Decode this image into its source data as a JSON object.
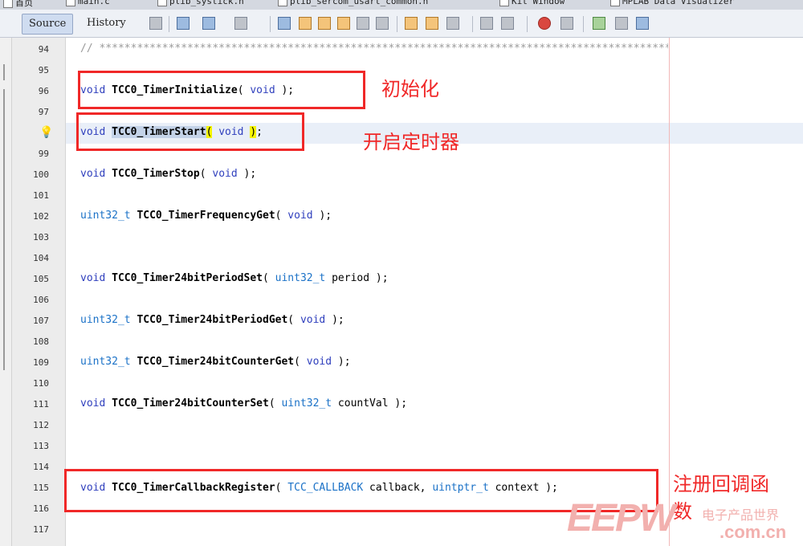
{
  "file_tabs": [
    {
      "label": "首页"
    },
    {
      "label": "main.c"
    },
    {
      "label": "plib_systick.h"
    },
    {
      "label": "plib_sercom_usart_common.h"
    },
    {
      "label": "Kit Window"
    },
    {
      "label": "MPLAB Data Visualizer"
    }
  ],
  "toolbar": {
    "source_label": "Source",
    "history_label": "History"
  },
  "editor": {
    "line_numbers": [
      "94",
      "95",
      "96",
      "97",
      "98",
      "99",
      "100",
      "101",
      "102",
      "103",
      "104",
      "105",
      "106",
      "107",
      "108",
      "109",
      "110",
      "111",
      "112",
      "113",
      "114",
      "115",
      "116",
      "117"
    ],
    "comment_line": "// ************************************************************************************************************",
    "lines": {
      "l96": {
        "kw": "void",
        "fn": "TCC0_TimerInitialize",
        "open": "(",
        "param_kw": "void",
        "close": ");"
      },
      "l98": {
        "kw": "void",
        "fn": "TCC0_TimerStart",
        "open": "(",
        "param_kw": "void",
        "close": ")",
        "semi": ";"
      },
      "l100": {
        "kw": "void",
        "fn": "TCC0_TimerStop",
        "open": "(",
        "param_kw": "void",
        "close": ");"
      },
      "l102": {
        "ty": "uint32_t",
        "fn": "TCC0_TimerFrequencyGet",
        "open": "(",
        "param_kw": "void",
        "close": ");"
      },
      "l105": {
        "kw": "void",
        "fn": "TCC0_Timer24bitPeriodSet",
        "open": "(",
        "param_ty": "uint32_t",
        "param_name": "period",
        "close": ");"
      },
      "l107": {
        "ty": "uint32_t",
        "fn": "TCC0_Timer24bitPeriodGet",
        "open": "(",
        "param_kw": "void",
        "close": ");"
      },
      "l109": {
        "ty": "uint32_t",
        "fn": "TCC0_Timer24bitCounterGet",
        "open": "(",
        "param_kw": "void",
        "close": ");"
      },
      "l111": {
        "kw": "void",
        "fn": "TCC0_Timer24bitCounterSet",
        "open": "(",
        "param_ty": "uint32_t",
        "param_name": "countVal",
        "close": ");"
      },
      "l115": {
        "kw": "void",
        "fn": "TCC0_TimerCallbackRegister",
        "open": "(",
        "param_ty": "TCC_CALLBACK",
        "param_name": "callback,",
        "param_ty2": "uintptr_t",
        "param_name2": "context",
        "close": ");"
      }
    }
  },
  "annotations": {
    "initialize": "初始化",
    "start_timer": "开启定时器",
    "register_callback_1": "注册回调函",
    "register_callback_2": "数"
  },
  "watermark": {
    "logo": "EEPW",
    "cn": "电子产品世界",
    "domain": ".com.cn"
  },
  "colors": {
    "keyword": "#2f3fbd",
    "type": "#1a71c7",
    "annotation": "#f02828",
    "selection": "#c4d3e8",
    "brace_match": "#f5f500",
    "current_line": "#e9eff8",
    "watermark": "#f2b0ae"
  },
  "icons": {
    "hint": "lightbulb-icon"
  }
}
